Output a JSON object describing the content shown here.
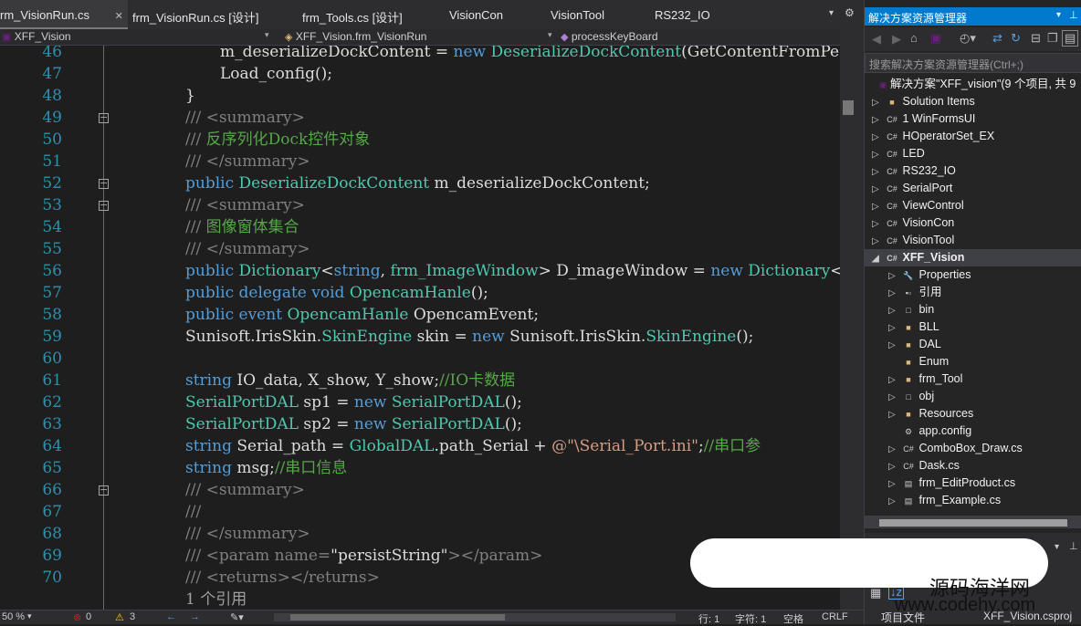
{
  "tabs": [
    {
      "label": "rm_VisionRun.cs",
      "active": true,
      "close": "✕"
    },
    {
      "label": "frm_VisionRun.cs [设计]"
    },
    {
      "label": "frm_Tools.cs [设计]"
    },
    {
      "label": "VisionCon"
    },
    {
      "label": "VisionTool"
    },
    {
      "label": "RS232_IO"
    }
  ],
  "nav": {
    "project": "XFF_Vision",
    "class": "XFF_Vision.frm_VisionRun",
    "member": "processKeyBoard"
  },
  "line_numbers": [
    "46",
    "47",
    "48",
    "49",
    "50",
    "51",
    "52",
    "53",
    "54",
    "55",
    "56",
    "57",
    "58",
    "59",
    "60",
    "61",
    "62",
    "63",
    "64",
    "65",
    "66",
    "67",
    "68",
    "69",
    "70"
  ],
  "code": {
    "l46": [
      "m_deserializeDockContent = ",
      "new",
      " ",
      "DeserializeDockContent",
      "(GetContentFromPe"
    ],
    "l47": "Load_config();",
    "l48": "}",
    "l49": [
      "///",
      " <summary>"
    ],
    "l50": [
      "///",
      " 反序列化Dock控件对象"
    ],
    "l51": [
      "///",
      " </summary>"
    ],
    "l52": [
      "public",
      " ",
      "DeserializeDockContent",
      " m_deserializeDockContent;"
    ],
    "l53": [
      "///",
      " <summary>"
    ],
    "l54": [
      "///",
      " 图像窗体集合"
    ],
    "l55": [
      "///",
      " </summary>"
    ],
    "l56": [
      "public",
      " ",
      "Dictionary",
      "<",
      "string",
      ", ",
      "frm_ImageWindow",
      "> D_imageWindow = ",
      "new",
      " ",
      "Dictionary",
      "<"
    ],
    "l57": [
      "public",
      " ",
      "delegate",
      " ",
      "void",
      " ",
      "OpencamHanle",
      "();"
    ],
    "l58": [
      "public",
      " ",
      "event",
      " ",
      "OpencamHanle",
      " OpencamEvent;"
    ],
    "l59": [
      "Sunisoft.IrisSkin.",
      "SkinEngine",
      " skin = ",
      "new",
      " Sunisoft.IrisSkin.",
      "SkinEngine",
      "();"
    ],
    "l61": [
      "string",
      " IO_data, X_show, Y_show;",
      "//IO卡数据"
    ],
    "l62": [
      "SerialPortDAL",
      " sp1 = ",
      "new",
      " ",
      "SerialPortDAL",
      "();"
    ],
    "l63": [
      "SerialPortDAL",
      " sp2 = ",
      "new",
      " ",
      "SerialPortDAL",
      "();"
    ],
    "l64": [
      "string",
      " Serial_path = ",
      "GlobalDAL",
      ".path_Serial + ",
      "@\"\\Serial_Port.ini\"",
      ";",
      "//串口参"
    ],
    "l65": [
      "string",
      " msg;",
      "//串口信息"
    ],
    "l66": [
      "///",
      " <summary>"
    ],
    "l67": "///",
    "l68": [
      "///",
      " </summary>"
    ],
    "l69": [
      "///",
      " <param name=",
      "\"persistString\"",
      "></param>"
    ],
    "l70": [
      "///",
      " <returns></returns>"
    ],
    "ref": "1 个引用"
  },
  "status": {
    "zoom": "50 %",
    "errors": "0",
    "warnings": "3",
    "row": "行: 1",
    "char": "字符: 1",
    "space": "空格",
    "eol": "CRLF"
  },
  "panel": {
    "title": "解决方案资源管理器",
    "search_placeholder": "搜索解决方案资源管理器(Ctrl+;)",
    "tree": [
      {
        "label": "解决方案\"XFF_vision\"(9 个项目, 共 9",
        "icon": "solution",
        "depth": 0
      },
      {
        "label": "Solution Items",
        "icon": "folder",
        "depth": 1
      },
      {
        "label": "1 WinFormsUI",
        "icon": "csproj",
        "depth": 1
      },
      {
        "label": "HOperatorSet_EX",
        "icon": "csproj",
        "depth": 1
      },
      {
        "label": "LED",
        "icon": "csproj",
        "depth": 1
      },
      {
        "label": "RS232_IO",
        "icon": "csproj",
        "depth": 1
      },
      {
        "label": "SerialPort",
        "icon": "csproj",
        "depth": 1
      },
      {
        "label": "ViewControl",
        "icon": "csproj",
        "depth": 1
      },
      {
        "label": "VisionCon",
        "icon": "csproj",
        "depth": 1
      },
      {
        "label": "VisionTool",
        "icon": "csproj",
        "depth": 1
      },
      {
        "label": "XFF_Vision",
        "icon": "csproj",
        "depth": 1,
        "selected": true
      },
      {
        "label": "Properties",
        "icon": "wrench",
        "depth": 2
      },
      {
        "label": "引用",
        "icon": "refs",
        "depth": 2
      },
      {
        "label": "bin",
        "icon": "folder-dashed",
        "depth": 2
      },
      {
        "label": "BLL",
        "icon": "folder",
        "depth": 2
      },
      {
        "label": "DAL",
        "icon": "folder",
        "depth": 2
      },
      {
        "label": "Enum",
        "icon": "folder",
        "depth": 2
      },
      {
        "label": "frm_Tool",
        "icon": "folder",
        "depth": 2
      },
      {
        "label": "obj",
        "icon": "folder-dashed",
        "depth": 2
      },
      {
        "label": "Resources",
        "icon": "folder",
        "depth": 2
      },
      {
        "label": "app.config",
        "icon": "config",
        "depth": 2
      },
      {
        "label": "ComboBox_Draw.cs",
        "icon": "cs",
        "depth": 2
      },
      {
        "label": "Dask.cs",
        "icon": "cs",
        "depth": 2
      },
      {
        "label": "frm_EditProduct.cs",
        "icon": "form",
        "depth": 2
      },
      {
        "label": "frm_Example.cs",
        "icon": "form",
        "depth": 2
      }
    ],
    "bottom_label": "项目文件",
    "bottom_file": "XFF_Vision.csproj"
  },
  "watermark": {
    "line1": "源码海洋网",
    "line2": "www.codehy.com"
  },
  "colors": {
    "keyword": "#569cd6",
    "type": "#4ec9b0",
    "comment": "#57a64a",
    "xmldoc": "#808080",
    "string": "#d69d85",
    "line_number": "#2b91af",
    "accent": "#007acc"
  }
}
